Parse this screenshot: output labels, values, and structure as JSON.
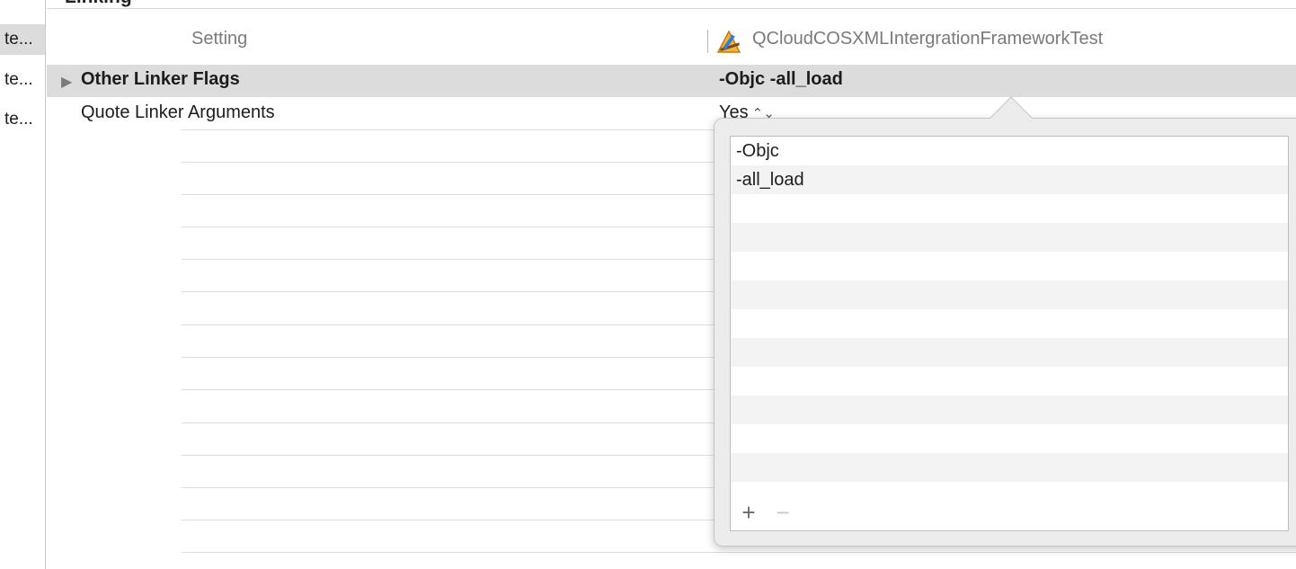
{
  "section": {
    "title": "Linking"
  },
  "sidebar": {
    "items": [
      {
        "label": "te..."
      },
      {
        "label": "te..."
      },
      {
        "label": "te..."
      }
    ]
  },
  "columns": {
    "setting_header": "Setting",
    "target_header": "QCloudCOSXMLIntergrationFrameworkTest",
    "target_icon": "xcode-target-icon"
  },
  "settings": [
    {
      "name": "Other Linker Flags",
      "value": "-Objc -all_load"
    },
    {
      "name": "Quote Linker Arguments",
      "value": "Yes",
      "value_control": "stepper-icon"
    }
  ],
  "popover": {
    "list_items": [
      "-Objc",
      "-all_load"
    ],
    "add_label": "+",
    "remove_label": "−"
  },
  "colors": {
    "selected_row": "#dcdcdc",
    "popover_bg": "#ececec"
  }
}
